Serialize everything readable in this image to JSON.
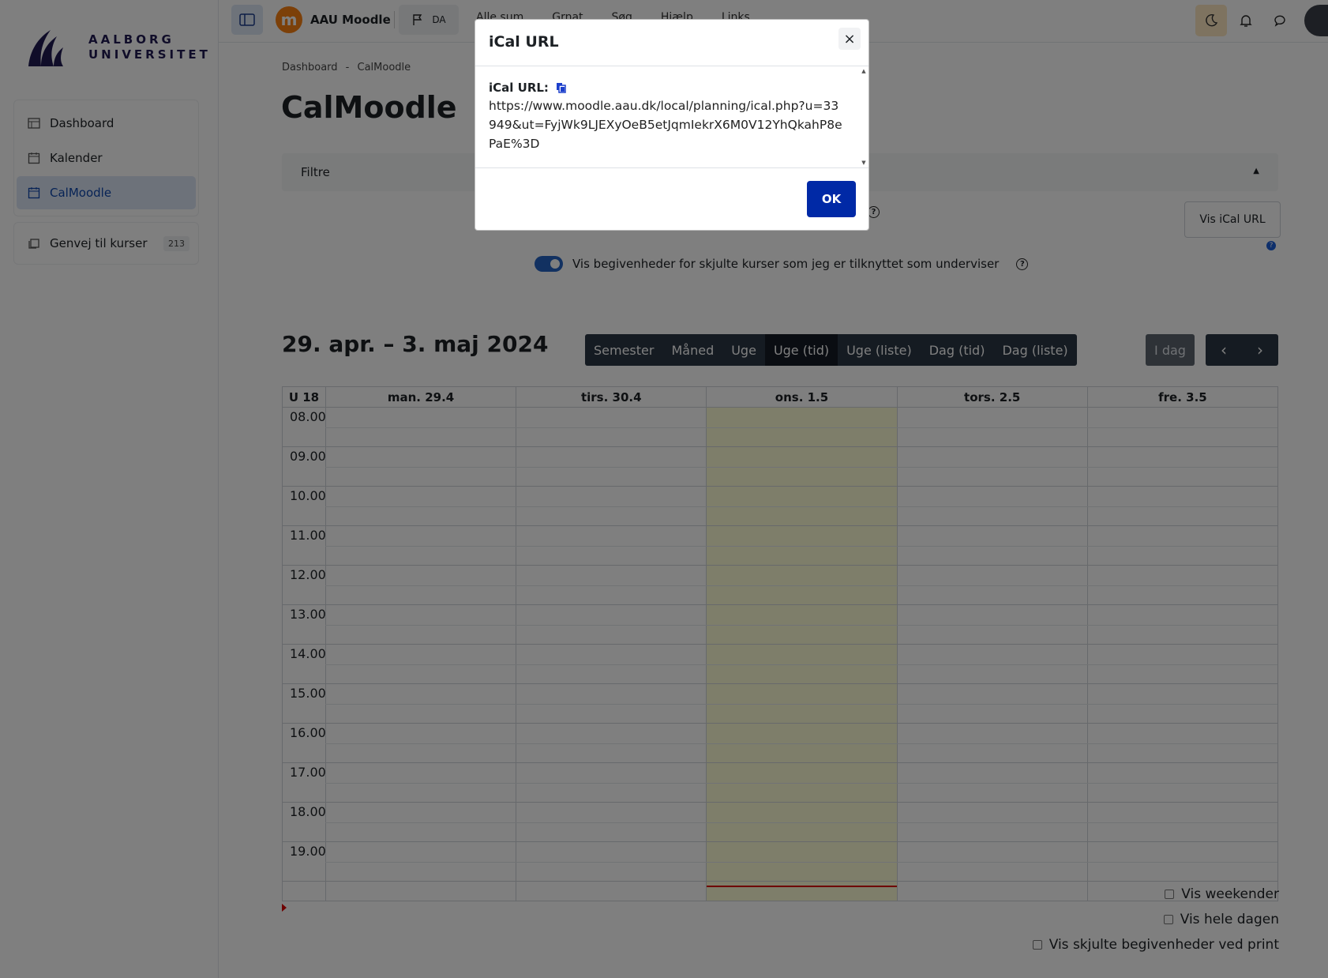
{
  "sidebar": {
    "logo_line1": "AALBORG",
    "logo_line2": "UNIVERSITET",
    "items": [
      {
        "label": "Dashboard",
        "icon": "dashboard-icon"
      },
      {
        "label": "Kalender",
        "icon": "calendar-icon"
      },
      {
        "label": "CalMoodle",
        "icon": "calendar-icon",
        "active": true
      }
    ],
    "shortcut": {
      "label": "Genvej til kurser",
      "count": "213",
      "icon": "courses-icon"
    }
  },
  "topbar": {
    "brand": "AAU Moodle",
    "lang": "DA",
    "menu": [
      "Alle sum",
      "Grnat",
      "Søg",
      "Hjælp",
      "Links"
    ]
  },
  "main": {
    "breadcrumb": [
      "Dashboard",
      "CalMoodle"
    ],
    "breadcrumb_sep": "-",
    "title": "CalMoodle",
    "filter_label": "Filtre",
    "toggle_hidden_label": "Vis begivenheder for skjulte kurser som jeg er tilknyttet som underviser",
    "ical_button": "Vis iCal URL",
    "range_title": "29. apr. – 3. maj 2024",
    "views": [
      "Semester",
      "Måned",
      "Uge",
      "Uge (tid)",
      "Uge (liste)",
      "Dag (tid)",
      "Dag (liste)"
    ],
    "active_view": "Uge (tid)",
    "today_button": "I dag",
    "prev": "‹",
    "next": "›"
  },
  "calendar": {
    "week_label": "U 18",
    "days": [
      "man. 29.4",
      "tirs. 30.4",
      "ons. 1.5",
      "tors. 2.5",
      "fre. 3.5"
    ],
    "today_index": 2,
    "hours": [
      "08.00",
      "09.00",
      "10.00",
      "11.00",
      "12.00",
      "13.00",
      "14.00",
      "15.00",
      "16.00",
      "17.00",
      "18.00",
      "19.00"
    ],
    "today_color": "#fdfcd5",
    "now_line_color": "#dd0000"
  },
  "options": {
    "weekends": "Vis weekender",
    "whole_day": "Vis hele dagen",
    "print_hidden": "Vis skjulte begivenheder ved print"
  },
  "modal": {
    "title": "iCal URL",
    "label": "iCal URL:",
    "url": "https://www.moodle.aau.dk/local/planning/ical.php?u=33949&ut=FyjWk9LJEXyOeB5etJqmIekrX6M0V12YhQkahP8ePaE%3D",
    "ok": "OK",
    "close": "×"
  }
}
